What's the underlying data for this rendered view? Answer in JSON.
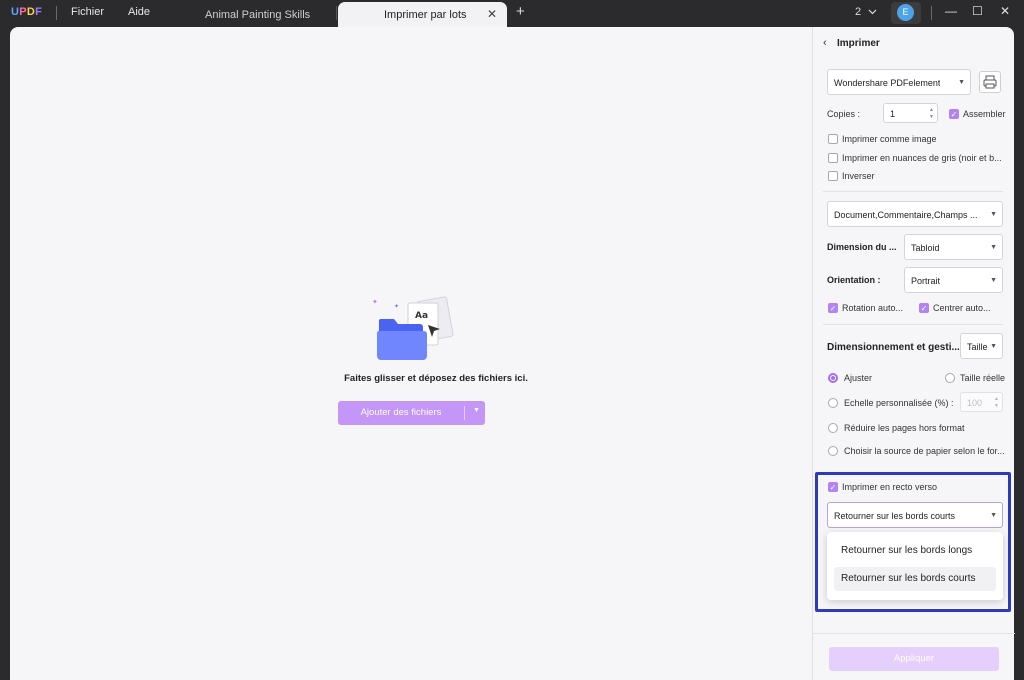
{
  "app": {
    "logo": "UPDF",
    "menu": [
      "Fichier",
      "Aide"
    ],
    "tabs": [
      {
        "label": "Animal Painting Skills",
        "active": false
      },
      {
        "label": "Imprimer par lots",
        "active": true
      }
    ],
    "page_count": "2",
    "avatar_letter": "E",
    "accent_color": "#b483f2",
    "icons": [
      "chevron-down-icon",
      "minimize-icon",
      "maximize-icon",
      "close-icon",
      "plus-icon",
      "printer-icon"
    ]
  },
  "canvas": {
    "drop_text": "Faites glisser et déposez des fichiers ici.",
    "add_button": "Ajouter des fichiers"
  },
  "panel": {
    "title": "Imprimer",
    "printer": "Wondershare PDFelement",
    "copies_label": "Copies :",
    "copies_value": "1",
    "assemble_label": "Assembler",
    "assemble_checked": true,
    "print_as_image": "Imprimer comme image",
    "grayscale": "Imprimer en nuances de gris (noir et b...",
    "invert": "Inverser",
    "content_select": "Document,Commentaire,Champs ...",
    "dimension_label": "Dimension du ...",
    "dimension_value": "Tabloid",
    "orientation_label": "Orientation :",
    "orientation_value": "Portrait",
    "auto_rotate": "Rotation auto...",
    "auto_center": "Centrer auto...",
    "sizing_label": "Dimensionnement et gesti...",
    "sizing_value": "Taille",
    "fit": "Ajuster",
    "actual_size": "Taille réelle",
    "custom_scale": "Echelle personnalisée (%) :",
    "custom_scale_value": "100",
    "shrink": "Réduire les pages hors format",
    "paper_source": "Choisir la source de papier selon le for...",
    "duplex_label": "Imprimer en recto verso",
    "duplex_checked": true,
    "flip_value": "Retourner sur les bords courts",
    "flip_options": [
      "Retourner sur les bords longs",
      "Retourner sur les bords courts"
    ],
    "apply": "Appliquer"
  }
}
